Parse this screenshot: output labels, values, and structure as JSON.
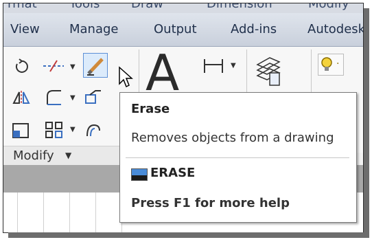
{
  "menubar": {
    "items": [
      "rmat",
      "Tools",
      "Draw",
      "Dimension",
      "Modify"
    ]
  },
  "ribbon_tabs": [
    "View",
    "Manage",
    "Output",
    "Add-ins",
    "Autodesk"
  ],
  "modify_panel": {
    "label": "Modify",
    "caret": "▼"
  },
  "icons": {
    "rotate": "rotate-icon",
    "trim": "trim-icon",
    "erase": "erase-icon",
    "mirror": "mirror-icon",
    "fillet": "fillet-icon",
    "stretch": "stretch-icon",
    "scale": "scale-icon",
    "array": "array-icon",
    "offset": "offset-icon",
    "text": "text-icon",
    "dimension": "dimension-icon",
    "layers": "layer-properties-icon",
    "lightbulb": "lightbulb-icon"
  },
  "text_tool": {
    "glyph": "A"
  },
  "tooltip": {
    "title": "Erase",
    "description": "Removes objects from a drawing",
    "command": "ERASE",
    "help": "Press F1 for more help"
  }
}
